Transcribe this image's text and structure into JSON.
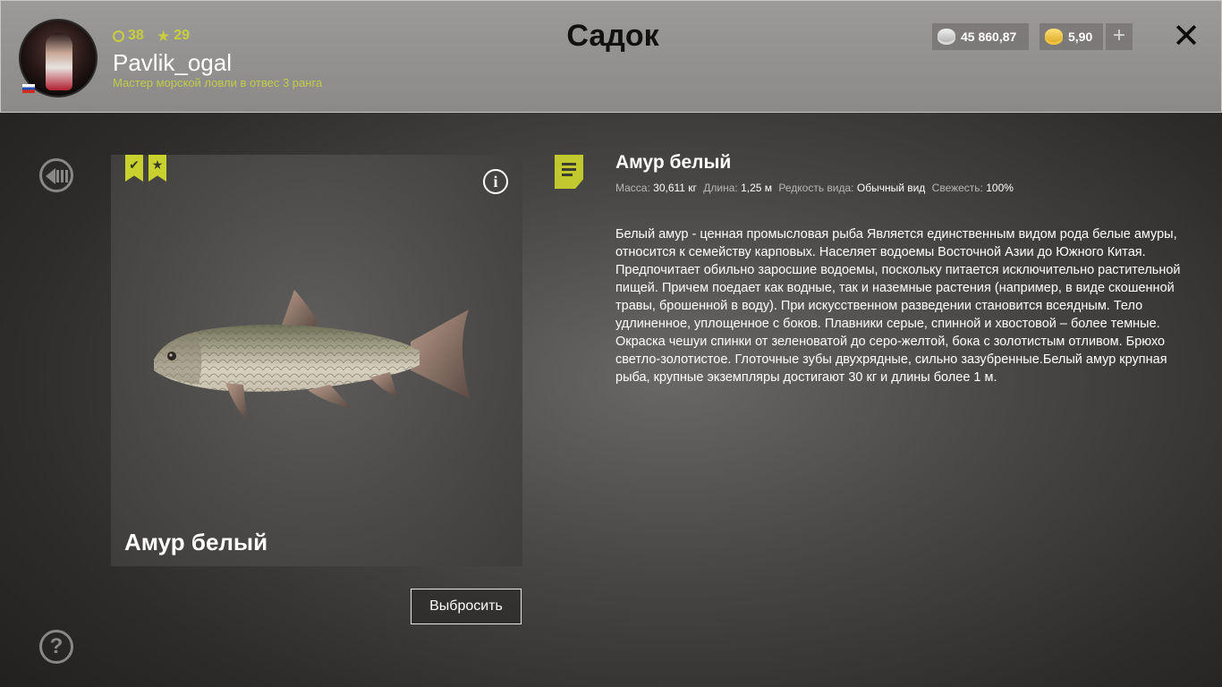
{
  "header": {
    "title": "Садок",
    "player": {
      "level": "38",
      "stars": "29",
      "username": "Pavlik_ogal",
      "rank_title": "Мастер морской ловли в отвес 3 ранга"
    },
    "silver_amount": "45 860,87",
    "gold_amount": "5,90",
    "add_label": "+",
    "close_label": "✕"
  },
  "fish_card": {
    "name": "Амур белый",
    "info_label": "i",
    "bookmark_1_glyph": "✔",
    "bookmark_2_glyph": "★",
    "discard_label": "Выбросить"
  },
  "details": {
    "title": "Амур белый",
    "mass_label": "Масса:",
    "mass_value": "30,611 кг",
    "length_label": "Длина:",
    "length_value": "1,25 м",
    "rarity_label": "Редкость вида:",
    "rarity_value": "Обычный вид",
    "freshness_label": "Свежесть:",
    "freshness_value": "100%",
    "description": "Белый амур - ценная промысловая рыба Является единственным видом рода белые амуры, относится к семейству карповых. Населяет водоемы Восточной Азии до Южного Китая. Предпочитает обильно заросшие водоемы, поскольку питается исключительно растительной пищей. Причем поедает как водные, так и наземные растения (например, в виде скошенной травы, брошенной в воду). При искусственном разведении становится всеядным. Тело удлиненное, уплощенное с боков. Плавники серые, спинной и хвостовой – более темные. Окраска чешуи спинки от зеленоватой до серо-желтой, бока с золотистым отливом. Брюхо светло-золотистое. Глоточные зубы двухрядные, сильно зазубренные.Белый амур крупная рыба, крупные экземпляры достигают 30 кг и длины более 1 м."
  },
  "side": {
    "help_label": "?"
  },
  "colors": {
    "accent": "#c8cf3c",
    "header_bg": "#9c9a98",
    "text": "#ffffff"
  },
  "icons": [
    "avatar",
    "flag-ru-icon",
    "level-ring-icon",
    "star-icon",
    "silver-coin-icon",
    "gold-coin-icon",
    "plus-icon",
    "close-icon",
    "back-icon",
    "help-icon",
    "checkmark-bookmark-icon",
    "star-bookmark-icon",
    "info-icon",
    "note-icon"
  ]
}
